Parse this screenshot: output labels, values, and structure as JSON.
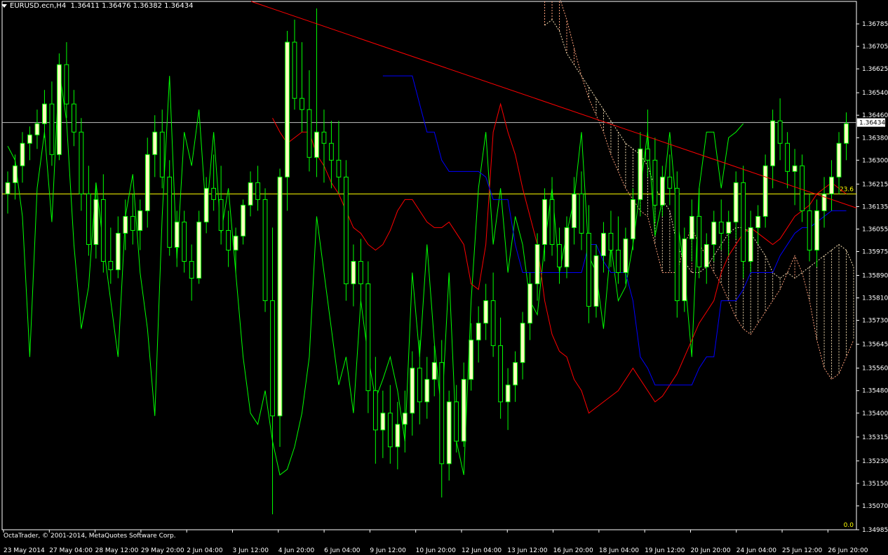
{
  "header": {
    "symbol": "EURUSD.ecn,H4",
    "ohlc": "1.36411 1.36476 1.36382 1.36434"
  },
  "footer": {
    "copyright": "OctaTrader, © 2001-2014, MetaQuotes Software Corp."
  },
  "colors": {
    "background": "#000000",
    "frame": "#ffffff",
    "candle": "#ffffc0",
    "chikou": "#00ff00",
    "tenkan": "#ff0000",
    "kijun": "#0000ff",
    "cloud_a": "#f5deb3",
    "cloud_b": "#ffa07a",
    "fib_line": "#ffff00",
    "trendline": "#ff0000",
    "price_line": "#c0c0c0"
  },
  "chart_data": {
    "type": "candlestick",
    "symbol": "EURUSD.ecn",
    "timeframe": "H4",
    "y_ticks": [
      "1.36785",
      "1.36705",
      "1.36625",
      "1.36540",
      "1.36460",
      "1.36380",
      "1.36300",
      "1.36215",
      "1.36135",
      "1.36055",
      "1.35975",
      "1.35890",
      "1.35810",
      "1.35730",
      "1.35645",
      "1.35560",
      "1.35480",
      "1.35400",
      "1.35315",
      "1.35230",
      "1.35150",
      "1.35070",
      "1.34985"
    ],
    "ylim": [
      1.34985,
      1.36865
    ],
    "x_ticks": [
      "23 May 2014",
      "27 May 04:00",
      "28 May 12:00",
      "29 May 20:00",
      "2 Jun 04:00",
      "3 Jun 12:00",
      "4 Jun 20:00",
      "6 Jun 04:00",
      "9 Jun 12:00",
      "10 Jun 20:00",
      "12 Jun 04:00",
      "13 Jun 12:00",
      "16 Jun 20:00",
      "18 Jun 04:00",
      "19 Jun 12:00",
      "20 Jun 20:00",
      "24 Jun 04:00",
      "25 Jun 12:00",
      "26 Jun 20:00"
    ],
    "current_price": "1.36434",
    "fib_labels": {
      "level_23_6": "23.6",
      "level_0": "0.0"
    },
    "fib_23_6_price": 1.3618,
    "candles": [
      [
        1.3618,
        1.3626,
        1.3611,
        1.3622
      ],
      [
        1.3622,
        1.3632,
        1.3616,
        1.3628
      ],
      [
        1.3628,
        1.364,
        1.3622,
        1.3636
      ],
      [
        1.3636,
        1.3642,
        1.363,
        1.3639
      ],
      [
        1.3639,
        1.3648,
        1.3634,
        1.3643
      ],
      [
        1.3643,
        1.3655,
        1.3638,
        1.365
      ],
      [
        1.365,
        1.3658,
        1.3628,
        1.3632
      ],
      [
        1.3632,
        1.3668,
        1.363,
        1.3664
      ],
      [
        1.3664,
        1.3672,
        1.3645,
        1.365
      ],
      [
        1.365,
        1.3655,
        1.3635,
        1.364
      ],
      [
        1.364,
        1.3645,
        1.3612,
        1.3618
      ],
      [
        1.3618,
        1.3628,
        1.3596,
        1.36
      ],
      [
        1.36,
        1.3622,
        1.3595,
        1.3616
      ],
      [
        1.3616,
        1.3625,
        1.359,
        1.3594
      ],
      [
        1.3594,
        1.3606,
        1.3586,
        1.3591
      ],
      [
        1.3591,
        1.361,
        1.3588,
        1.3604
      ],
      [
        1.3604,
        1.3616,
        1.3598,
        1.361
      ],
      [
        1.361,
        1.3618,
        1.36,
        1.3605
      ],
      [
        1.3605,
        1.3616,
        1.3598,
        1.3612
      ],
      [
        1.3612,
        1.3638,
        1.3606,
        1.3632
      ],
      [
        1.3632,
        1.3646,
        1.3624,
        1.364
      ],
      [
        1.364,
        1.3648,
        1.362,
        1.3624
      ],
      [
        1.3624,
        1.363,
        1.3596,
        1.3599
      ],
      [
        1.3599,
        1.3612,
        1.3592,
        1.3608
      ],
      [
        1.3608,
        1.3612,
        1.359,
        1.3594
      ],
      [
        1.3594,
        1.36,
        1.358,
        1.3588
      ],
      [
        1.3588,
        1.3612,
        1.3586,
        1.3608
      ],
      [
        1.3608,
        1.3624,
        1.3604,
        1.362
      ],
      [
        1.362,
        1.3632,
        1.3612,
        1.3616
      ],
      [
        1.3616,
        1.3628,
        1.36,
        1.3605
      ],
      [
        1.3605,
        1.3612,
        1.3592,
        1.3598
      ],
      [
        1.3598,
        1.3606,
        1.359,
        1.3603
      ],
      [
        1.3603,
        1.3616,
        1.36,
        1.3614
      ],
      [
        1.3614,
        1.3626,
        1.361,
        1.3622
      ],
      [
        1.3622,
        1.3628,
        1.3612,
        1.3616
      ],
      [
        1.3616,
        1.362,
        1.3576,
        1.358
      ],
      [
        1.358,
        1.3606,
        1.3504,
        1.3539
      ],
      [
        1.3539,
        1.3627,
        1.3528,
        1.3624
      ],
      [
        1.3624,
        1.3676,
        1.3612,
        1.3672
      ],
      [
        1.3672,
        1.368,
        1.3648,
        1.3652
      ],
      [
        1.3652,
        1.3672,
        1.364,
        1.3648
      ],
      [
        1.3648,
        1.3662,
        1.3626,
        1.3631
      ],
      [
        1.3631,
        1.3684,
        1.3624,
        1.364
      ],
      [
        1.364,
        1.3648,
        1.3622,
        1.3636
      ],
      [
        1.3636,
        1.3644,
        1.362,
        1.363
      ],
      [
        1.363,
        1.3644,
        1.3618,
        1.3624
      ],
      [
        1.3624,
        1.363,
        1.358,
        1.3586
      ],
      [
        1.3586,
        1.36,
        1.3578,
        1.3594
      ],
      [
        1.3594,
        1.3602,
        1.358,
        1.3586
      ],
      [
        1.3586,
        1.3594,
        1.354,
        1.3548
      ],
      [
        1.3548,
        1.356,
        1.3522,
        1.3534
      ],
      [
        1.3534,
        1.3548,
        1.3524,
        1.354
      ],
      [
        1.354,
        1.355,
        1.3522,
        1.3528
      ],
      [
        1.3528,
        1.3544,
        1.352,
        1.3536
      ],
      [
        1.3536,
        1.3548,
        1.3526,
        1.354
      ],
      [
        1.354,
        1.3562,
        1.3532,
        1.3556
      ],
      [
        1.3556,
        1.3566,
        1.3536,
        1.3544
      ],
      [
        1.3544,
        1.356,
        1.3538,
        1.3552
      ],
      [
        1.3552,
        1.3564,
        1.3546,
        1.3558
      ],
      [
        1.3558,
        1.3566,
        1.351,
        1.3522
      ],
      [
        1.3522,
        1.3548,
        1.3516,
        1.3544
      ],
      [
        1.3544,
        1.355,
        1.3526,
        1.353
      ],
      [
        1.353,
        1.3558,
        1.3528,
        1.3552
      ],
      [
        1.3552,
        1.3572,
        1.3548,
        1.3566
      ],
      [
        1.3566,
        1.3578,
        1.3558,
        1.3572
      ],
      [
        1.3572,
        1.3586,
        1.3566,
        1.358
      ],
      [
        1.358,
        1.359,
        1.356,
        1.3564
      ],
      [
        1.3564,
        1.3574,
        1.3538,
        1.3544
      ],
      [
        1.3544,
        1.3556,
        1.3534,
        1.355
      ],
      [
        1.355,
        1.3562,
        1.3544,
        1.3558
      ],
      [
        1.3558,
        1.3576,
        1.3552,
        1.3572
      ],
      [
        1.3572,
        1.359,
        1.3566,
        1.3586
      ],
      [
        1.3586,
        1.3604,
        1.358,
        1.36
      ],
      [
        1.36,
        1.362,
        1.3594,
        1.3616
      ],
      [
        1.3616,
        1.3624,
        1.3596,
        1.36
      ],
      [
        1.36,
        1.3606,
        1.3586,
        1.3592
      ],
      [
        1.3592,
        1.361,
        1.3588,
        1.3606
      ],
      [
        1.3606,
        1.3624,
        1.36,
        1.3618
      ],
      [
        1.3618,
        1.3626,
        1.3598,
        1.3604
      ],
      [
        1.3604,
        1.3614,
        1.3572,
        1.3578
      ],
      [
        1.3578,
        1.36,
        1.3574,
        1.3596
      ],
      [
        1.3596,
        1.3608,
        1.359,
        1.3604
      ],
      [
        1.3604,
        1.3612,
        1.3592,
        1.3598
      ],
      [
        1.3598,
        1.361,
        1.3586,
        1.359
      ],
      [
        1.359,
        1.3606,
        1.3586,
        1.3602
      ],
      [
        1.3602,
        1.362,
        1.3598,
        1.3616
      ],
      [
        1.3616,
        1.364,
        1.361,
        1.3634
      ],
      [
        1.3634,
        1.3648,
        1.3624,
        1.363
      ],
      [
        1.363,
        1.3638,
        1.3608,
        1.3614
      ],
      [
        1.3614,
        1.3628,
        1.361,
        1.3624
      ],
      [
        1.3624,
        1.3632,
        1.3614,
        1.362
      ],
      [
        1.362,
        1.3626,
        1.3574,
        1.358
      ],
      [
        1.358,
        1.3606,
        1.3576,
        1.3602
      ],
      [
        1.3602,
        1.3616,
        1.3594,
        1.361
      ],
      [
        1.361,
        1.362,
        1.3588,
        1.3592
      ],
      [
        1.3592,
        1.3604,
        1.3586,
        1.36
      ],
      [
        1.36,
        1.3612,
        1.3594,
        1.3608
      ],
      [
        1.3608,
        1.3616,
        1.3598,
        1.3604
      ],
      [
        1.3604,
        1.3612,
        1.3596,
        1.3608
      ],
      [
        1.3608,
        1.3626,
        1.3602,
        1.3622
      ],
      [
        1.3622,
        1.3628,
        1.3588,
        1.3594
      ],
      [
        1.3594,
        1.3612,
        1.359,
        1.3606
      ],
      [
        1.3606,
        1.3614,
        1.36,
        1.361
      ],
      [
        1.361,
        1.3632,
        1.3606,
        1.3628
      ],
      [
        1.3628,
        1.3648,
        1.362,
        1.3644
      ],
      [
        1.3644,
        1.3652,
        1.363,
        1.3636
      ],
      [
        1.3636,
        1.364,
        1.362,
        1.3626
      ],
      [
        1.3626,
        1.3634,
        1.3614,
        1.3628
      ],
      [
        1.3628,
        1.3632,
        1.3608,
        1.3612
      ],
      [
        1.3612,
        1.3618,
        1.3594,
        1.3598
      ],
      [
        1.3598,
        1.3616,
        1.3592,
        1.3612
      ],
      [
        1.3612,
        1.3624,
        1.3606,
        1.3618
      ],
      [
        1.3618,
        1.363,
        1.3612,
        1.3624
      ],
      [
        1.3624,
        1.364,
        1.3618,
        1.3636
      ],
      [
        1.3636,
        1.3647,
        1.363,
        1.3643
      ]
    ],
    "chikou": [
      1.3635,
      1.363,
      1.361,
      1.356,
      1.362,
      1.364,
      1.3608,
      1.3662,
      1.3644,
      1.36,
      1.357,
      1.3585,
      1.3622,
      1.36,
      1.358,
      1.356,
      1.361,
      1.3625,
      1.359,
      1.357,
      1.3539,
      1.361,
      1.366,
      1.3595,
      1.364,
      1.3628,
      1.3648,
      1.361,
      1.364,
      1.3604,
      1.362,
      1.359,
      1.356,
      1.354,
      1.3536,
      1.3548,
      1.353,
      1.3518,
      1.352,
      1.3528,
      1.354,
      1.356,
      1.361,
      1.359,
      1.357,
      1.355,
      1.356,
      1.354,
      1.358,
      1.356,
      1.3545,
      1.3552,
      1.356,
      1.3548,
      1.353,
      1.359,
      1.356,
      1.36,
      1.3565,
      1.354,
      1.359,
      1.353,
      1.3518,
      1.358,
      1.362,
      1.364,
      1.36,
      1.362,
      1.359,
      1.361,
      1.36,
      1.358,
      1.3575,
      1.36,
      1.362,
      1.359,
      1.3604,
      1.3616,
      1.364,
      1.3596,
      1.359,
      1.357,
      1.36,
      1.358,
      1.3585,
      1.36,
      1.362,
      1.364,
      1.3603,
      1.3616,
      1.364,
      1.361,
      1.359,
      1.356,
      1.362,
      1.364,
      1.364,
      1.362,
      1.3638,
      1.364,
      1.3643
    ],
    "tenkan": [
      1.3645,
      1.364,
      1.3636,
      1.3638,
      1.364,
      1.364,
      1.3632,
      1.3628,
      1.3622,
      1.3618,
      1.3612,
      1.3606,
      1.3604,
      1.36,
      1.3598,
      1.36,
      1.3605,
      1.3612,
      1.3616,
      1.3616,
      1.3612,
      1.3608,
      1.3606,
      1.3606,
      1.3608,
      1.3604,
      1.36,
      1.3586,
      1.3584,
      1.36,
      1.364,
      1.365,
      1.364,
      1.3632,
      1.362,
      1.361,
      1.36,
      1.358,
      1.3568,
      1.3562,
      1.356,
      1.3552,
      1.3548,
      1.354,
      1.3542,
      1.3544,
      1.3546,
      1.3548,
      1.3552,
      1.3556,
      1.3552,
      1.3548,
      1.3544,
      1.3546,
      1.355,
      1.3554,
      1.356,
      1.3566,
      1.3572,
      1.3576,
      1.358,
      1.359,
      1.3596,
      1.36,
      1.3604,
      1.3606,
      1.3604,
      1.3602,
      1.36,
      1.3602,
      1.3606,
      1.361,
      1.3612,
      1.3614,
      1.3618,
      1.362,
      1.3622,
      1.362,
      1.3618
    ],
    "kijun": [
      1.366,
      1.366,
      1.366,
      1.366,
      1.366,
      1.365,
      1.364,
      1.364,
      1.363,
      1.3626,
      1.3626,
      1.3626,
      1.3626,
      1.3626,
      1.3624,
      1.3616,
      1.3616,
      1.3616,
      1.36,
      1.359,
      1.359,
      1.359,
      1.359,
      1.359,
      1.359,
      1.359,
      1.359,
      1.359,
      1.36,
      1.36,
      1.3594,
      1.359,
      1.359,
      1.359,
      1.358,
      1.356,
      1.3556,
      1.355,
      1.355,
      1.355,
      1.355,
      1.355,
      1.355,
      1.3556,
      1.356,
      1.356,
      1.358,
      1.358,
      1.358,
      1.3584,
      1.359,
      1.359,
      1.359,
      1.359,
      1.3596,
      1.36,
      1.3604,
      1.3606,
      1.3606,
      1.3608,
      1.361,
      1.3612,
      1.3612,
      1.3612
    ],
    "senkou_a": [
      1.3678,
      1.368,
      1.3676,
      1.3668,
      1.3664,
      1.366,
      1.3656,
      1.3652,
      1.3648,
      1.3644,
      1.364,
      1.3636,
      1.3634,
      1.3632,
      1.3628,
      1.362,
      1.3616,
      1.3612,
      1.36,
      1.3594,
      1.359,
      1.359,
      1.3592,
      1.3596,
      1.36,
      1.3604,
      1.3606,
      1.3606,
      1.3604,
      1.36,
      1.3596,
      1.359,
      1.3588,
      1.359,
      1.3588,
      1.359,
      1.3592,
      1.3594,
      1.3596,
      1.3598,
      1.36,
      1.3598,
      1.3592,
      1.359,
      1.359,
      1.3592,
      1.3594,
      1.3596
    ],
    "senkou_b": [
      1.3688,
      1.3688,
      1.3688,
      1.368,
      1.367,
      1.366,
      1.3652,
      1.3646,
      1.364,
      1.3632,
      1.3626,
      1.362,
      1.3616,
      1.3612,
      1.361,
      1.36,
      1.359,
      1.359,
      1.359,
      1.36,
      1.3606,
      1.36,
      1.3596,
      1.359,
      1.3586,
      1.358,
      1.3574,
      1.357,
      1.3568,
      1.3572,
      1.3576,
      1.358,
      1.3584,
      1.359,
      1.3596,
      1.359,
      1.358,
      1.3566,
      1.3556,
      1.3552,
      1.3554,
      1.356,
      1.3566,
      1.3572,
      1.358,
      1.3586,
      1.359,
      1.3594
    ],
    "trendline": {
      "from": [
        1.369,
        "start"
      ],
      "to": [
        1.3613,
        "end"
      ]
    }
  }
}
